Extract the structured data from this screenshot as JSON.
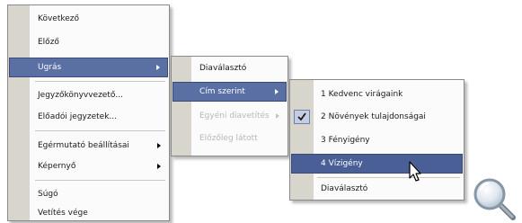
{
  "main_menu": {
    "items": [
      {
        "label": "Következő"
      },
      {
        "label": "Előző"
      },
      {
        "label": "Ugrás"
      },
      {
        "label": "Jegyzőkönyvvezető..."
      },
      {
        "label": "Előadói jegyzetek..."
      },
      {
        "label": "Egérmutató beállításai"
      },
      {
        "label": "Képernyő"
      },
      {
        "label": "Súgó"
      },
      {
        "label": "Vetítés vége"
      }
    ]
  },
  "goto_submenu": {
    "items": [
      {
        "label": "Diaválasztó"
      },
      {
        "label": "Cím szerint"
      },
      {
        "label": "Egyéni diavetítés"
      },
      {
        "label": "Előzőleg látott"
      }
    ]
  },
  "title_submenu": {
    "items": [
      {
        "label": "1 Kedvenc virágaink"
      },
      {
        "label": "2 Növények tulajdonságai"
      },
      {
        "label": "3 Fényigény"
      },
      {
        "label": "4 Vízigény"
      },
      {
        "label": "Diaválasztó"
      }
    ]
  },
  "icons": {
    "submenu_arrow": "chevron-right-icon",
    "check": "check-icon",
    "cursor": "mouse-pointer-icon",
    "magnifier": "magnifier-icon"
  },
  "colors": {
    "highlight": "#5a6fa3",
    "highlight_border": "#3b4a76",
    "gutter": "#d8d5cd",
    "menu_bg": "#fbfbfb",
    "disabled_text": "#b8b8b8"
  }
}
